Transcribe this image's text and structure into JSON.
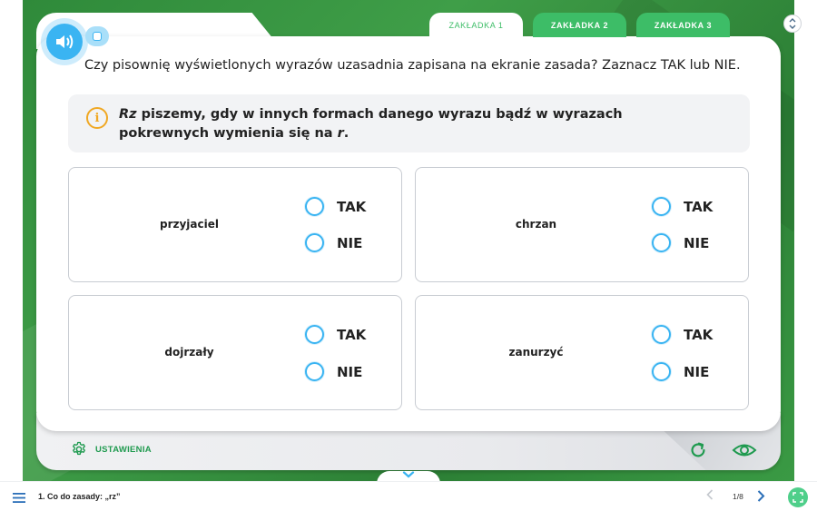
{
  "tabs": [
    {
      "label": "ZAKŁADKA 1",
      "active": true
    },
    {
      "label": "ZAKŁADKA 2",
      "active": false
    },
    {
      "label": "ZAKŁADKA 3",
      "active": false
    }
  ],
  "instruction": "Czy pisownię wyświetlonych wyrazów uzasadnia zapisana na ekranie zasada? Zaznacz TAK lub NIE.",
  "rule": {
    "icon": "info-icon",
    "icon_glyph": "i",
    "part1_italic": "Rz",
    "part2": " piszemy, gdy w innych formach danego wyrazu bądź w wyrazach pokrewnych wymienia się na ",
    "part3_italic": "r",
    "part4": "."
  },
  "questions": [
    {
      "word": "przyjaciel",
      "options": [
        "TAK",
        "NIE"
      ]
    },
    {
      "word": "chrzan",
      "options": [
        "TAK",
        "NIE"
      ]
    },
    {
      "word": "dojrzały",
      "options": [
        "TAK",
        "NIE"
      ]
    },
    {
      "word": "zanurzyć",
      "options": [
        "TAK",
        "NIE"
      ]
    }
  ],
  "footer": {
    "settings_label": "USTAWIENIA"
  },
  "bottom_bar": {
    "lesson_title": "1. Co do zasady: „rz”",
    "page": "1/8"
  },
  "colors": {
    "accent_green": "#3dbd67",
    "dark_green": "#1f9a4f",
    "radio_blue": "#3ab4f2",
    "info_orange": "#f0a824"
  }
}
